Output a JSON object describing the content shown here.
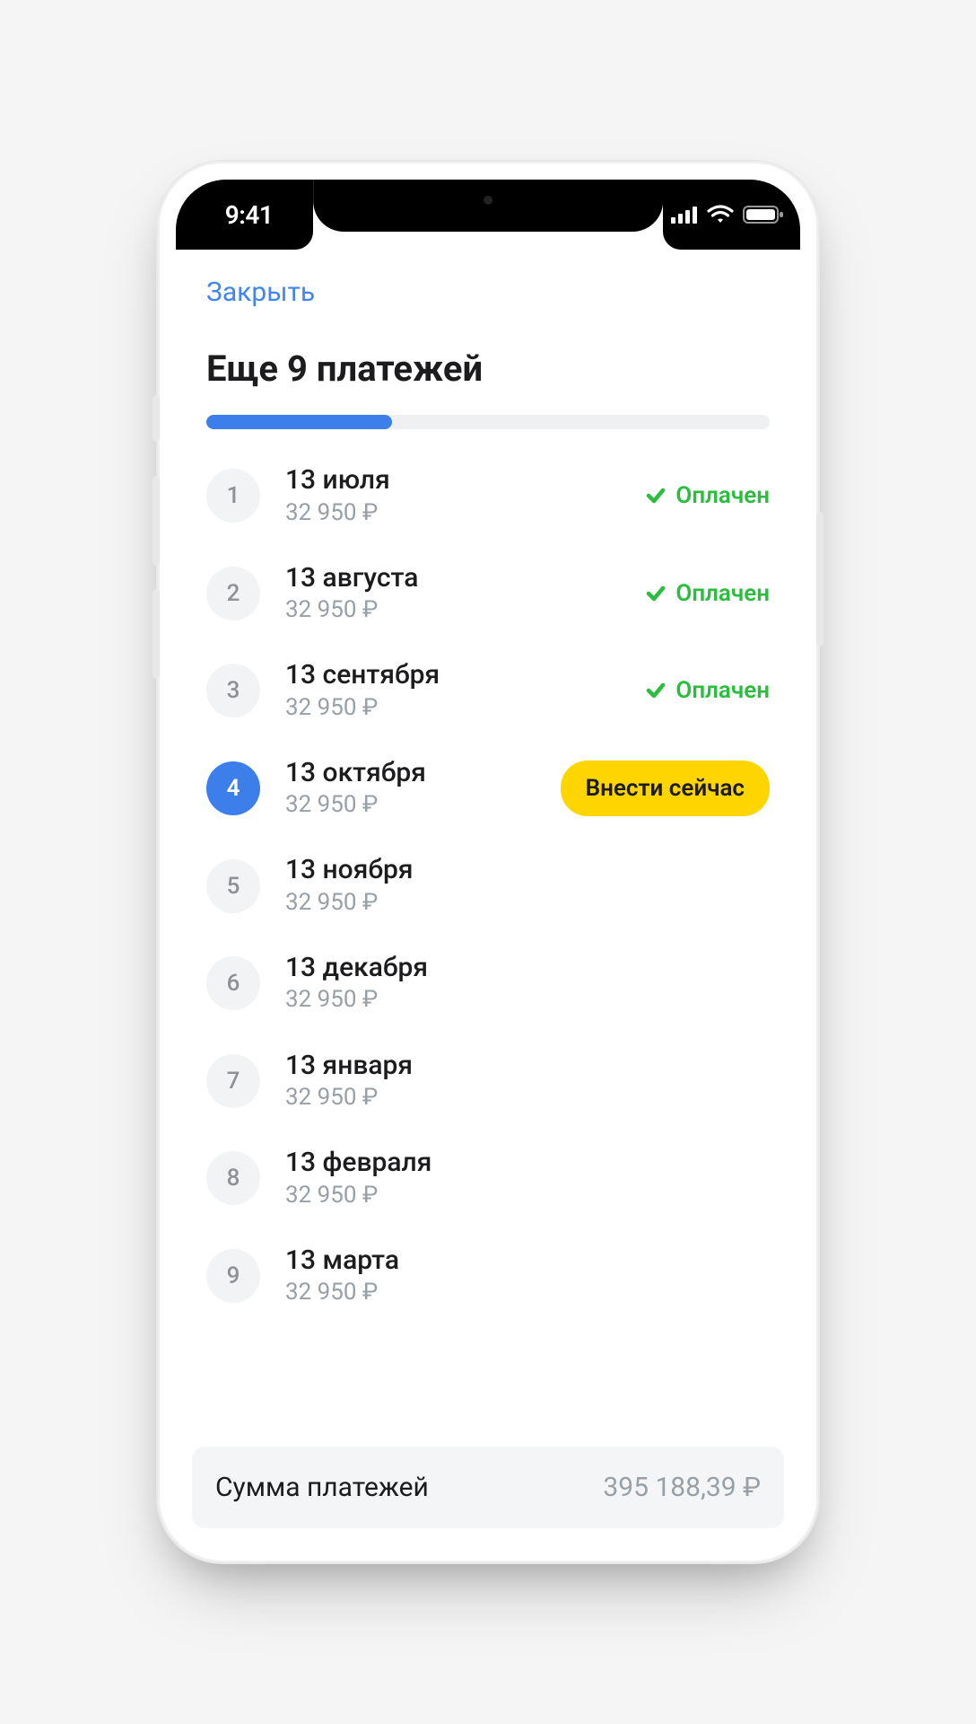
{
  "status": {
    "time": "9:41"
  },
  "header": {
    "close_label": "Закрыть",
    "title": "Еще 9 платежей"
  },
  "progress_percent": 33,
  "colors": {
    "accent_blue": "#3c7eea",
    "link_blue": "#4185f2",
    "success_green": "#2bbd3e",
    "action_yellow": "#ffd500"
  },
  "status_paid_label": "Оплачен",
  "pay_now_label": "Внести сейчас",
  "payments": [
    {
      "idx": "1",
      "date": "13 июля",
      "amount": "32 950 ₽",
      "state": "paid"
    },
    {
      "idx": "2",
      "date": "13 августа",
      "amount": "32 950 ₽",
      "state": "paid"
    },
    {
      "idx": "3",
      "date": "13 сентября",
      "amount": "32 950 ₽",
      "state": "paid"
    },
    {
      "idx": "4",
      "date": "13 октября",
      "amount": "32 950 ₽",
      "state": "current"
    },
    {
      "idx": "5",
      "date": "13 ноября",
      "amount": "32 950 ₽",
      "state": "future"
    },
    {
      "idx": "6",
      "date": "13 декабря",
      "amount": "32 950 ₽",
      "state": "future"
    },
    {
      "idx": "7",
      "date": "13 января",
      "amount": "32 950 ₽",
      "state": "future"
    },
    {
      "idx": "8",
      "date": "13 февраля",
      "amount": "32 950 ₽",
      "state": "future"
    },
    {
      "idx": "9",
      "date": "13 марта",
      "amount": "32 950 ₽",
      "state": "future"
    }
  ],
  "summary": {
    "label": "Сумма платежей",
    "value": "395 188,39 ₽"
  }
}
